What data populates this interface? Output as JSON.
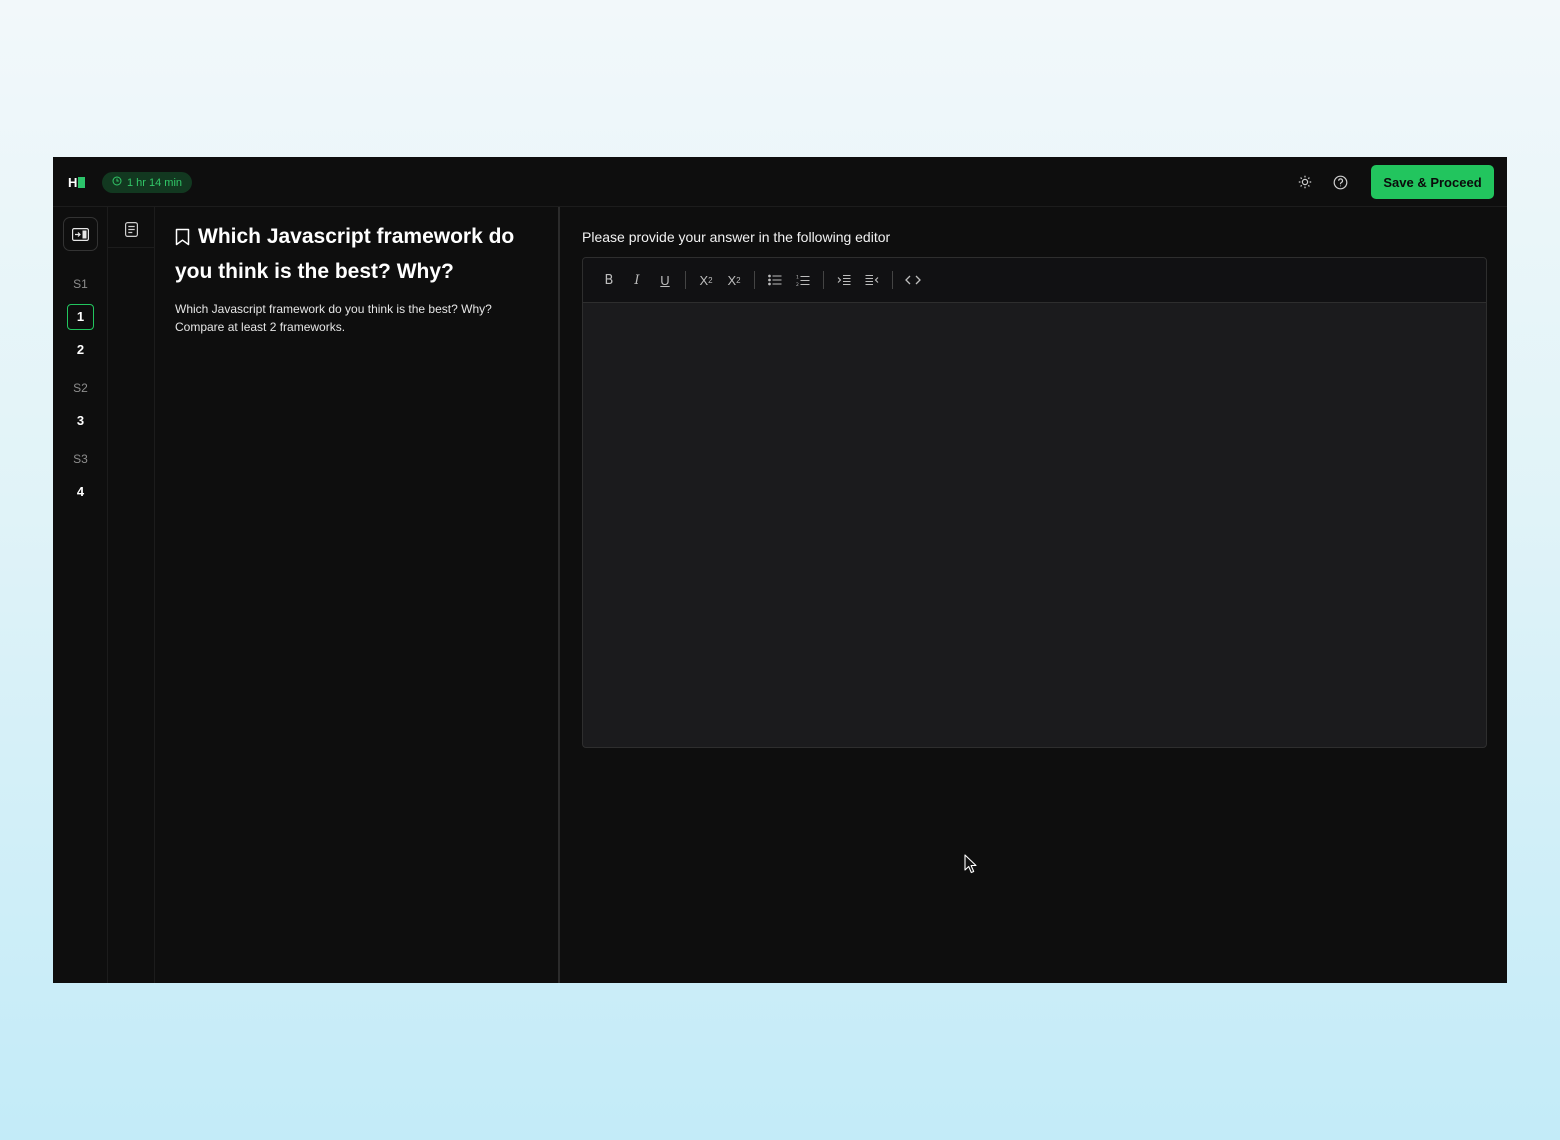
{
  "header": {
    "logo_text": "H",
    "timer": "1 hr 14 min",
    "save_label": "Save & Proceed",
    "icons": [
      "sun-icon",
      "help-icon"
    ]
  },
  "sidebar": {
    "sections": [
      {
        "label": "S1",
        "questions": [
          "1",
          "2"
        ]
      },
      {
        "label": "S2",
        "questions": [
          "3"
        ]
      },
      {
        "label": "S3",
        "questions": [
          "4"
        ]
      }
    ],
    "active_question": "1"
  },
  "question": {
    "title": "Which Javascript framework do you think is the best? Why?",
    "body": "Which Javascript framework do you think is the best?  Why? Compare at least 2 frameworks."
  },
  "answer": {
    "label": "Please provide your answer in the following editor",
    "toolbar": [
      "bold",
      "italic",
      "underline",
      "superscript",
      "subscript",
      "bullet-list",
      "numbered-list",
      "indent",
      "outdent",
      "code"
    ],
    "content": ""
  },
  "colors": {
    "accent": "#22c55e",
    "app_bg": "#0e0e0e",
    "editor_bg": "#1b1b1d"
  }
}
